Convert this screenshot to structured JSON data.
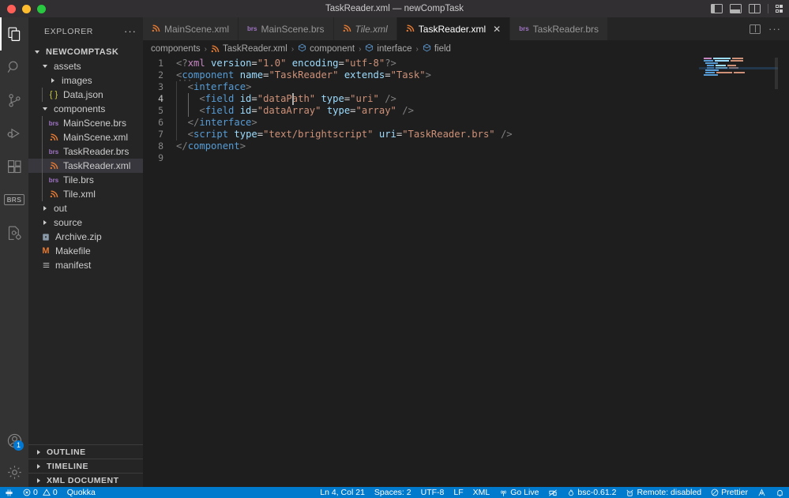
{
  "titlebar": {
    "title": "TaskReader.xml — newCompTask",
    "traffic_lights": [
      "close",
      "minimize",
      "zoom"
    ],
    "layout_icons": [
      "toggle-primary-sidebar",
      "toggle-panel",
      "toggle-secondary-sidebar",
      "customize-layout"
    ]
  },
  "activitybar": {
    "items": [
      {
        "name": "explorer",
        "icon": "files-icon",
        "active": true
      },
      {
        "name": "search",
        "icon": "search-icon",
        "active": false
      },
      {
        "name": "source-control",
        "icon": "source-control-icon",
        "active": false
      },
      {
        "name": "run-and-debug",
        "icon": "run-debug-icon",
        "active": false
      },
      {
        "name": "extensions",
        "icon": "extensions-icon",
        "active": false
      },
      {
        "name": "brightscript",
        "icon": "brs-icon",
        "label": "BRS",
        "active": false
      },
      {
        "name": "remote-explorer",
        "icon": "remote-explorer-icon",
        "active": false
      }
    ],
    "bottom": [
      {
        "name": "accounts",
        "icon": "account-icon",
        "badge": "1"
      },
      {
        "name": "manage-settings",
        "icon": "gear-icon",
        "badge": ""
      }
    ]
  },
  "sidebar": {
    "header_title": "EXPLORER",
    "more_actions": "···",
    "root": {
      "label": "NEWCOMPTASK",
      "expanded": true
    },
    "tree": [
      {
        "label": "assets",
        "depth": 1,
        "type": "folder",
        "expanded": true,
        "icon": "chevron-down-icon"
      },
      {
        "label": "images",
        "depth": 2,
        "type": "folder",
        "expanded": false,
        "icon": "chevron-right-icon"
      },
      {
        "label": "Data.json",
        "depth": 2,
        "type": "json",
        "icon": "json-file-icon"
      },
      {
        "label": "components",
        "depth": 1,
        "type": "folder",
        "expanded": true,
        "icon": "chevron-down-icon"
      },
      {
        "label": "MainScene.brs",
        "depth": 2,
        "type": "brs",
        "icon": "brs-file-icon"
      },
      {
        "label": "MainScene.xml",
        "depth": 2,
        "type": "xml",
        "icon": "xml-file-icon"
      },
      {
        "label": "TaskReader.brs",
        "depth": 2,
        "type": "brs",
        "icon": "brs-file-icon"
      },
      {
        "label": "TaskReader.xml",
        "depth": 2,
        "type": "xml",
        "icon": "xml-file-icon",
        "selected": true
      },
      {
        "label": "Tile.brs",
        "depth": 2,
        "type": "brs",
        "icon": "brs-file-icon"
      },
      {
        "label": "Tile.xml",
        "depth": 2,
        "type": "xml",
        "icon": "xml-file-icon"
      },
      {
        "label": "out",
        "depth": 1,
        "type": "folder",
        "expanded": false,
        "icon": "chevron-right-icon"
      },
      {
        "label": "source",
        "depth": 1,
        "type": "folder",
        "expanded": false,
        "icon": "chevron-right-icon"
      },
      {
        "label": "Archive.zip",
        "depth": 1,
        "type": "zip",
        "icon": "zip-file-icon"
      },
      {
        "label": "Makefile",
        "depth": 1,
        "type": "make",
        "icon": "makefile-icon"
      },
      {
        "label": "manifest",
        "depth": 1,
        "type": "manifest",
        "icon": "manifest-icon"
      }
    ],
    "panels": [
      {
        "label": "OUTLINE",
        "expanded": false
      },
      {
        "label": "TIMELINE",
        "expanded": false
      },
      {
        "label": "XML DOCUMENT",
        "expanded": false
      }
    ]
  },
  "tabs": [
    {
      "label": "MainScene.xml",
      "icon": "xml-file-icon",
      "active": false,
      "preview": false,
      "closable": false
    },
    {
      "label": "MainScene.brs",
      "icon": "brs-file-icon",
      "active": false,
      "preview": false,
      "closable": false
    },
    {
      "label": "Tile.xml",
      "icon": "xml-file-icon",
      "active": false,
      "preview": true,
      "closable": false
    },
    {
      "label": "TaskReader.xml",
      "icon": "xml-file-icon",
      "active": true,
      "preview": false,
      "closable": true,
      "close_glyph": "✕"
    },
    {
      "label": "TaskReader.brs",
      "icon": "brs-file-icon",
      "active": false,
      "preview": false,
      "closable": false
    }
  ],
  "tabbar_actions": [
    {
      "name": "split-editor-button",
      "icon": "split-editor-icon"
    },
    {
      "name": "more-actions-button",
      "icon": "ellipsis-icon",
      "glyph": "···"
    }
  ],
  "breadcrumbs": [
    {
      "label": "components",
      "icon": ""
    },
    {
      "label": "TaskReader.xml",
      "icon": "xml-file-icon"
    },
    {
      "label": "component",
      "icon": "symbol-field-icon"
    },
    {
      "label": "interface",
      "icon": "symbol-field-icon"
    },
    {
      "label": "field",
      "icon": "symbol-field-icon"
    }
  ],
  "editor": {
    "language": "XML",
    "lines": [
      {
        "n": "1",
        "indent": 0,
        "tokens": [
          {
            "t": "<?",
            "c": "punct"
          },
          {
            "t": "xml",
            "c": "decl"
          },
          {
            "t": " ",
            "c": "eq"
          },
          {
            "t": "version",
            "c": "attr"
          },
          {
            "t": "=",
            "c": "eq"
          },
          {
            "t": "\"1.0\"",
            "c": "str"
          },
          {
            "t": " ",
            "c": "eq"
          },
          {
            "t": "encoding",
            "c": "attr"
          },
          {
            "t": "=",
            "c": "eq"
          },
          {
            "t": "\"utf-8\"",
            "c": "str"
          },
          {
            "t": "?>",
            "c": "punct"
          }
        ]
      },
      {
        "n": "2",
        "indent": 0,
        "tokens": [
          {
            "t": "<",
            "c": "punct"
          },
          {
            "t": "component",
            "c": "tag"
          },
          {
            "t": " ",
            "c": "eq"
          },
          {
            "t": "name",
            "c": "attr"
          },
          {
            "t": "=",
            "c": "eq"
          },
          {
            "t": "\"TaskReader\"",
            "c": "str"
          },
          {
            "t": " ",
            "c": "eq"
          },
          {
            "t": "extends",
            "c": "attr"
          },
          {
            "t": "=",
            "c": "eq"
          },
          {
            "t": "\"Task\"",
            "c": "str"
          },
          {
            "t": ">",
            "c": "punct"
          }
        ]
      },
      {
        "n": "3",
        "indent": 1,
        "tokens": [
          {
            "t": "  <",
            "c": "punct"
          },
          {
            "t": "interface",
            "c": "tag"
          },
          {
            "t": ">",
            "c": "punct"
          }
        ]
      },
      {
        "n": "4",
        "indent": 2,
        "tokens": [
          {
            "t": "    <",
            "c": "punct"
          },
          {
            "t": "field",
            "c": "tag"
          },
          {
            "t": " ",
            "c": "eq"
          },
          {
            "t": "id",
            "c": "attr"
          },
          {
            "t": "=",
            "c": "eq"
          },
          {
            "t": "\"dataPath\"",
            "c": "str"
          },
          {
            "t": " ",
            "c": "eq"
          },
          {
            "t": "type",
            "c": "attr"
          },
          {
            "t": "=",
            "c": "eq"
          },
          {
            "t": "\"uri\"",
            "c": "str"
          },
          {
            "t": " />",
            "c": "punct"
          }
        ]
      },
      {
        "n": "5",
        "indent": 2,
        "tokens": [
          {
            "t": "    <",
            "c": "punct"
          },
          {
            "t": "field",
            "c": "tag"
          },
          {
            "t": " ",
            "c": "eq"
          },
          {
            "t": "id",
            "c": "attr"
          },
          {
            "t": "=",
            "c": "eq"
          },
          {
            "t": "\"dataArray\"",
            "c": "str"
          },
          {
            "t": " ",
            "c": "eq"
          },
          {
            "t": "type",
            "c": "attr"
          },
          {
            "t": "=",
            "c": "eq"
          },
          {
            "t": "\"array\"",
            "c": "str"
          },
          {
            "t": " />",
            "c": "punct"
          }
        ]
      },
      {
        "n": "6",
        "indent": 1,
        "tokens": [
          {
            "t": "  </",
            "c": "punct"
          },
          {
            "t": "interface",
            "c": "tag"
          },
          {
            "t": ">",
            "c": "punct"
          }
        ]
      },
      {
        "n": "7",
        "indent": 1,
        "tokens": [
          {
            "t": "  <",
            "c": "punct"
          },
          {
            "t": "script",
            "c": "tag"
          },
          {
            "t": " ",
            "c": "eq"
          },
          {
            "t": "type",
            "c": "attr"
          },
          {
            "t": "=",
            "c": "eq"
          },
          {
            "t": "\"text/brightscript\"",
            "c": "str"
          },
          {
            "t": " ",
            "c": "eq"
          },
          {
            "t": "uri",
            "c": "attr"
          },
          {
            "t": "=",
            "c": "eq"
          },
          {
            "t": "\"TaskReader.brs\"",
            "c": "str"
          },
          {
            "t": " />",
            "c": "punct"
          }
        ]
      },
      {
        "n": "8",
        "indent": 0,
        "tokens": [
          {
            "t": "</",
            "c": "punct"
          },
          {
            "t": "component",
            "c": "tag"
          },
          {
            "t": ">",
            "c": "punct"
          }
        ]
      },
      {
        "n": "9",
        "indent": 0,
        "tokens": []
      }
    ],
    "cursor_line": 4,
    "fold_marker": "···"
  },
  "statusbar": {
    "left": [
      {
        "name": "remote-indicator",
        "icon": "remote-icon",
        "label": ""
      },
      {
        "name": "problems",
        "icon": "error-warning-icon",
        "label": "0  0",
        "errors": "0",
        "warnings": "0"
      },
      {
        "name": "quokka",
        "icon": "",
        "label": "Quokka"
      }
    ],
    "right": [
      {
        "name": "editor-position",
        "label": "Ln 4, Col 21"
      },
      {
        "name": "editor-indentation",
        "label": "Spaces: 2"
      },
      {
        "name": "editor-encoding",
        "label": "UTF-8"
      },
      {
        "name": "editor-eol",
        "label": "LF"
      },
      {
        "name": "editor-language",
        "label": "XML"
      },
      {
        "name": "go-live",
        "icon": "broadcast-icon",
        "label": "Go Live"
      },
      {
        "name": "live-share",
        "icon": "live-share-icon",
        "label": ""
      },
      {
        "name": "brighterscript-version",
        "icon": "flame-icon",
        "label": "bsc-0.61.2"
      },
      {
        "name": "roku-remote",
        "icon": "remote-control-icon",
        "label": "Remote: disabled"
      },
      {
        "name": "prettier",
        "icon": "check-circle-icon",
        "label": "Prettier"
      },
      {
        "name": "feedback",
        "icon": "smiley-icon",
        "label": ""
      },
      {
        "name": "notifications",
        "icon": "bell-icon",
        "label": ""
      }
    ]
  },
  "colors": {
    "accent": "#007acc",
    "titlebar_bg": "#322f32",
    "activitybar_bg": "#333333",
    "sidebar_bg": "#252526",
    "editor_bg": "#1e1e1e",
    "tab_active_bg": "#1e1e1e",
    "tab_inactive_bg": "#2d2d2d",
    "selected_row_bg": "#37373d",
    "xml_icon": "#e37933",
    "brs_icon": "#a074c4",
    "json_icon": "#cbcb41",
    "tag": "#569cd6",
    "attr": "#9cdcfe",
    "string": "#ce9178",
    "declaration": "#c586c0"
  }
}
